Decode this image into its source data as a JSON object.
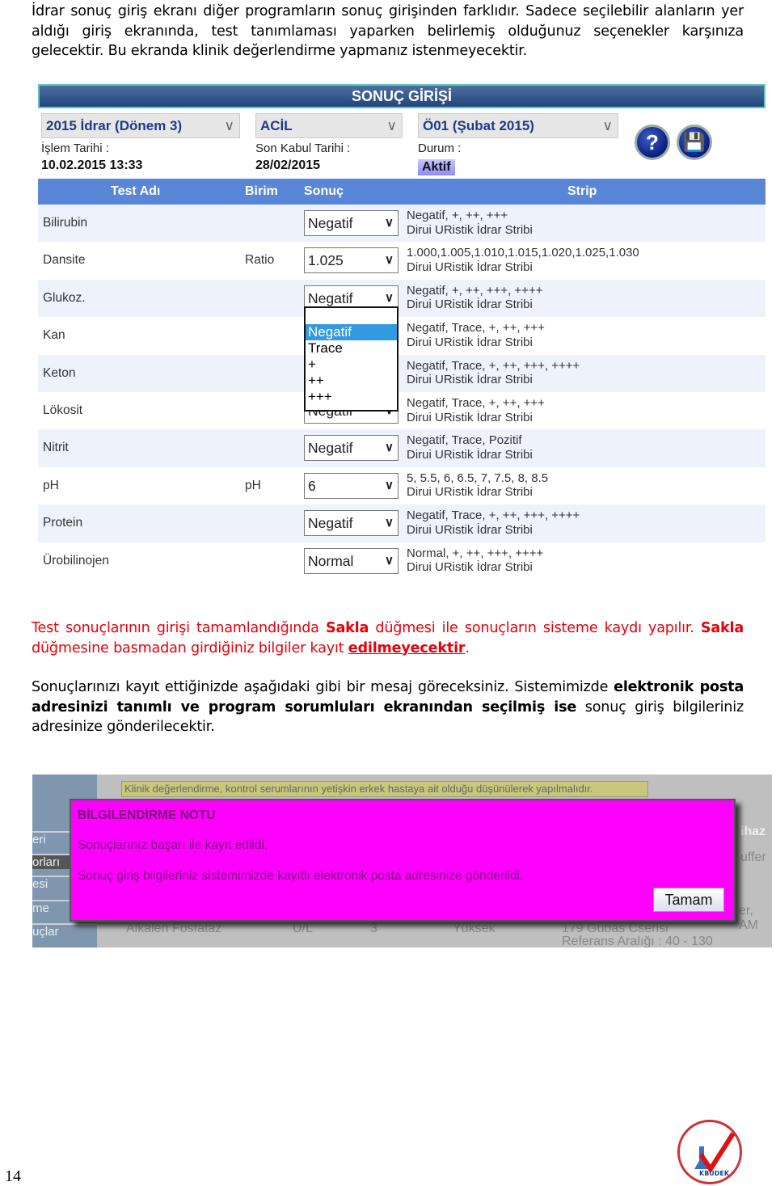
{
  "intro": "İdrar sonuç giriş ekranı diğer programların sonuç girişinden farklıdır. Sadece seçilebilir alanların yer aldığı giriş ekranında, test tanımlaması yaparken belirlemiş olduğunuz seçenekler karşınıza gelecektir. Bu ekranda klinik değerlendirme yapmanız istenmeyecektir.",
  "screen1": {
    "title": "SONUÇ GİRİŞİ",
    "program": "2015 İdrar (Dönem 3)",
    "priority": "ACİL",
    "period": "Ö01 (Şubat 2015)",
    "islem_label": "İşlem Tarihi :",
    "islem_value": "10.02.2015 13:33",
    "sonkabul_label": "Son Kabul Tarihi :",
    "sonkabul_value": "28/02/2015",
    "durum_label": "Durum :",
    "durum_value": "Aktif",
    "help_icon": "?",
    "save_icon": "floppy-disk",
    "headers": {
      "test": "Test Adı",
      "unit": "Birim",
      "result": "Sonuç",
      "strip": "Strip"
    },
    "rows": [
      {
        "name": "Bilirubin",
        "unit": "",
        "result": "Negatif",
        "options": "Negatif, +, ++, +++",
        "strip": "Dirui URistik İdrar Stribi"
      },
      {
        "name": "Dansite",
        "unit": "Ratio",
        "result": "1.025",
        "options": "1.000,1.005,1.010,1.015,1.020,1.025,1.030",
        "strip": "Dirui URistik İdrar Stribi"
      },
      {
        "name": "Glukoz.",
        "unit": "",
        "result": "Negatif",
        "options": "Negatif, +, ++, +++, ++++",
        "strip": "Dirui URistik İdrar Stribi"
      },
      {
        "name": "Kan",
        "unit": "",
        "result": "",
        "options": "Negatif, Trace, +, ++, +++",
        "strip": "Dirui URistik İdrar Stribi"
      },
      {
        "name": "Keton",
        "unit": "",
        "result": "",
        "options": "Negatif, Trace, +, ++, +++, ++++",
        "strip": "Dirui URistik İdrar Stribi"
      },
      {
        "name": "Lökosit",
        "unit": "",
        "result": "Negatif",
        "options": "Negatif, Trace, +, ++, +++",
        "strip": "Dirui URistik İdrar Stribi"
      },
      {
        "name": "Nitrit",
        "unit": "",
        "result": "Negatif",
        "options": "Negatif, Trace, Pozitif",
        "strip": "Dirui URistik İdrar Stribi"
      },
      {
        "name": "pH",
        "unit": "pH",
        "result": "6",
        "options": "5, 5.5, 6, 6.5, 7, 7.5, 8, 8.5",
        "strip": "Dirui URistik İdrar Stribi"
      },
      {
        "name": "Protein",
        "unit": "",
        "result": "Negatif",
        "options": "Negatif, Trace, +, ++, +++, ++++",
        "strip": "Dirui URistik İdrar Stribi"
      },
      {
        "name": "Ürobilinojen",
        "unit": "",
        "result": "Normal",
        "options": "Normal, +, ++, +++, ++++",
        "strip": "Dirui URistik İdrar Stribi"
      }
    ],
    "open_list": [
      "",
      "Negatif",
      "Trace",
      "+",
      "++",
      "+++"
    ]
  },
  "para2": {
    "a": "Test sonuçlarının girişi tamamlandığında ",
    "b": "Sakla",
    "c": " düğmesi ile sonuçların sisteme kaydı yapılır. ",
    "d": "Sakla",
    "e": " düğmesine basmadan girdiğiniz bilgiler kayıt ",
    "f": "edilmeyecektir",
    "g": "."
  },
  "para3": {
    "a": "Sonuçlarınızı kayıt ettiğinizde aşağıdaki gibi bir mesaj göreceksiniz. Sistemimizde ",
    "b": "elektronik posta adresinizi tanımlı ve program sorumluları ekranından seçilmiş ise",
    "c": " sonuç giriş bilgileriniz adresinize gönderilecektir."
  },
  "screen2": {
    "warning": "Klinik değerlendirme, kontrol serumlarının yetişkin erkek hastaya ait olduğu düşünülerek yapılmalıdır.",
    "sidebar": [
      "eri",
      "orları",
      "esi",
      "me",
      "uçlar"
    ],
    "bg_texts": [
      "ihaz",
      "uffer",
      "er, AM",
      "Alkalen Fosfataz",
      "U/L",
      "3",
      "Yüksek",
      "179 Gubas Cserisi",
      "Referans Aralığı : 40 - 130"
    ],
    "dialog_title": "BİLGİLENDİRME NOTU",
    "msg1": "Sonuçlarınız başarı ile kayıt edildi.",
    "msg2": "Sonuç giriş bilgileriniz sistemimizde kayıtlı elektronik posta adresinize gönderildi.",
    "ok": "Tamam"
  },
  "page_number": "14",
  "logo_text": "KBUDEK"
}
